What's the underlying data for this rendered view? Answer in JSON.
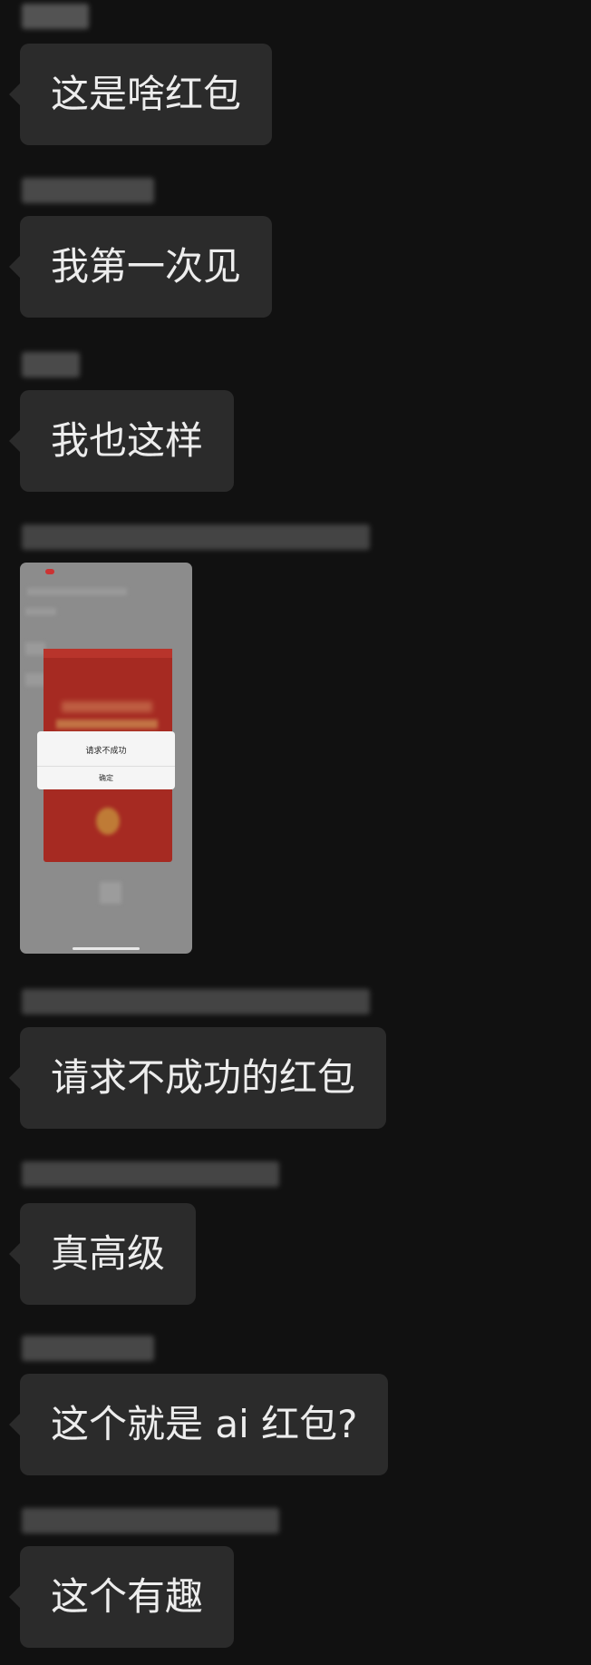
{
  "colors": {
    "background": "#111111",
    "bubble": "#2b2b2b",
    "bubble_text": "#ededed",
    "red_packet": "#a62a22"
  },
  "messages": [
    {
      "type": "text",
      "text": "这是啥红包"
    },
    {
      "type": "text",
      "text": "我第一次见"
    },
    {
      "type": "text",
      "text": "我也这样"
    },
    {
      "type": "image",
      "dialog_message": "请求不成功",
      "dialog_button": "确定"
    },
    {
      "type": "text",
      "text": "请求不成功的红包"
    },
    {
      "type": "text",
      "text": "真高级"
    },
    {
      "type": "text",
      "text": "这个就是 ai 红包?"
    },
    {
      "type": "text",
      "text": "这个有趣"
    }
  ]
}
